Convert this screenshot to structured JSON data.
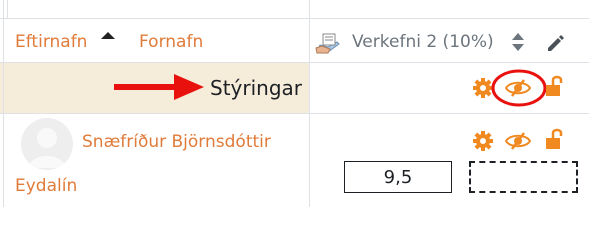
{
  "header": {
    "lastname_label": "Eftirnafn",
    "firstname_label": "Fornafn",
    "sort_direction": "ascending",
    "grade_item_label": "Verkefni 2 (10%)"
  },
  "controls_row": {
    "label": "Stýringar",
    "icons": [
      "gear-icon",
      "eye-slash-icon",
      "unlock-icon"
    ]
  },
  "student": {
    "name_line1": "Snæfríður Björnsdóttir",
    "name_line2": "Eydalín",
    "grade_value": "9,5",
    "icons": [
      "gear-icon",
      "eye-slash-icon",
      "unlock-icon"
    ]
  },
  "colors": {
    "link": "#e07b39",
    "icon_orange": "#f0891f",
    "control_row_bg": "#f6ecda",
    "annotation_red": "#e8110e"
  }
}
